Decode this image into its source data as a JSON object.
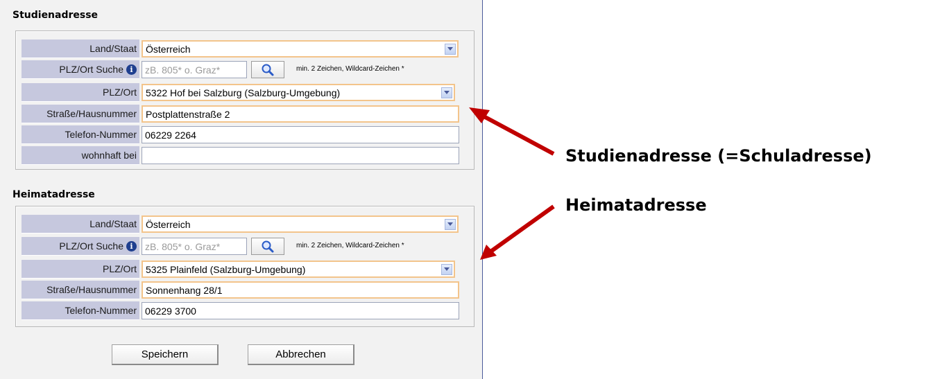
{
  "study": {
    "title": "Studienadresse",
    "rows": {
      "country_label": "Land/Staat",
      "country_value": "Österreich",
      "search_label": "PLZ/Ort Suche",
      "search_placeholder": "zB. 805* o. Graz*",
      "search_hint": "min. 2 Zeichen, Wildcard-Zeichen *",
      "plz_label": "PLZ/Ort",
      "plz_value": "5322 Hof bei Salzburg (Salzburg-Umgebung)",
      "street_label": "Straße/Hausnummer",
      "street_value": "Postplattenstraße 2",
      "phone_label": "Telefon-Nummer",
      "phone_value": "06229 2264",
      "livingwith_label": "wohnhaft bei",
      "livingwith_value": ""
    }
  },
  "home": {
    "title": "Heimatadresse",
    "rows": {
      "country_label": "Land/Staat",
      "country_value": "Österreich",
      "search_label": "PLZ/Ort Suche",
      "search_placeholder": "zB. 805* o. Graz*",
      "search_hint": "min. 2 Zeichen, Wildcard-Zeichen *",
      "plz_label": "PLZ/Ort",
      "plz_value": "5325 Plainfeld (Salzburg-Umgebung)",
      "street_label": "Straße/Hausnummer",
      "street_value": "Sonnenhang 28/1",
      "phone_label": "Telefon-Nummer",
      "phone_value": "06229 3700"
    }
  },
  "buttons": {
    "save": "Speichern",
    "cancel": "Abbrechen"
  },
  "annotations": {
    "study": "Studienadresse (=Schuladresse)",
    "home": "Heimatadresse"
  },
  "icons": {
    "info": "info-icon",
    "search": "magnifier-icon",
    "dropdown": "chevron-down-icon"
  },
  "colors": {
    "label_bg": "#c6c8de",
    "required_border": "#f3c48b",
    "arrow": "#c00000",
    "panel_border": "#4a5a9a"
  }
}
